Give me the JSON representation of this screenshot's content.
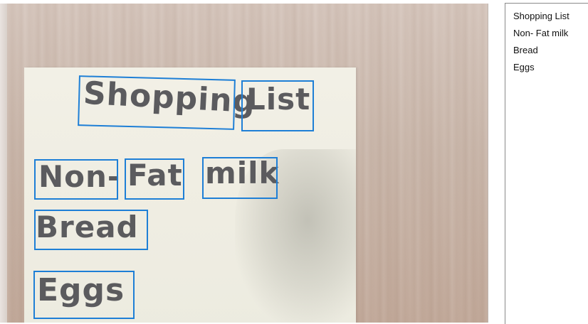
{
  "ocr_panel": {
    "lines": [
      "Shopping List",
      "Non- Fat milk",
      "Bread",
      "Eggs"
    ]
  },
  "photo": {
    "words": {
      "shopping": "Shopping",
      "list": "List",
      "non": "Non-",
      "fat": "Fat",
      "milk": "milk",
      "bread": "Bread",
      "eggs": "Eggs"
    }
  },
  "colors": {
    "box": "#1e7fd6",
    "ink": "#5b5b5e",
    "note": "#f0eee4"
  }
}
